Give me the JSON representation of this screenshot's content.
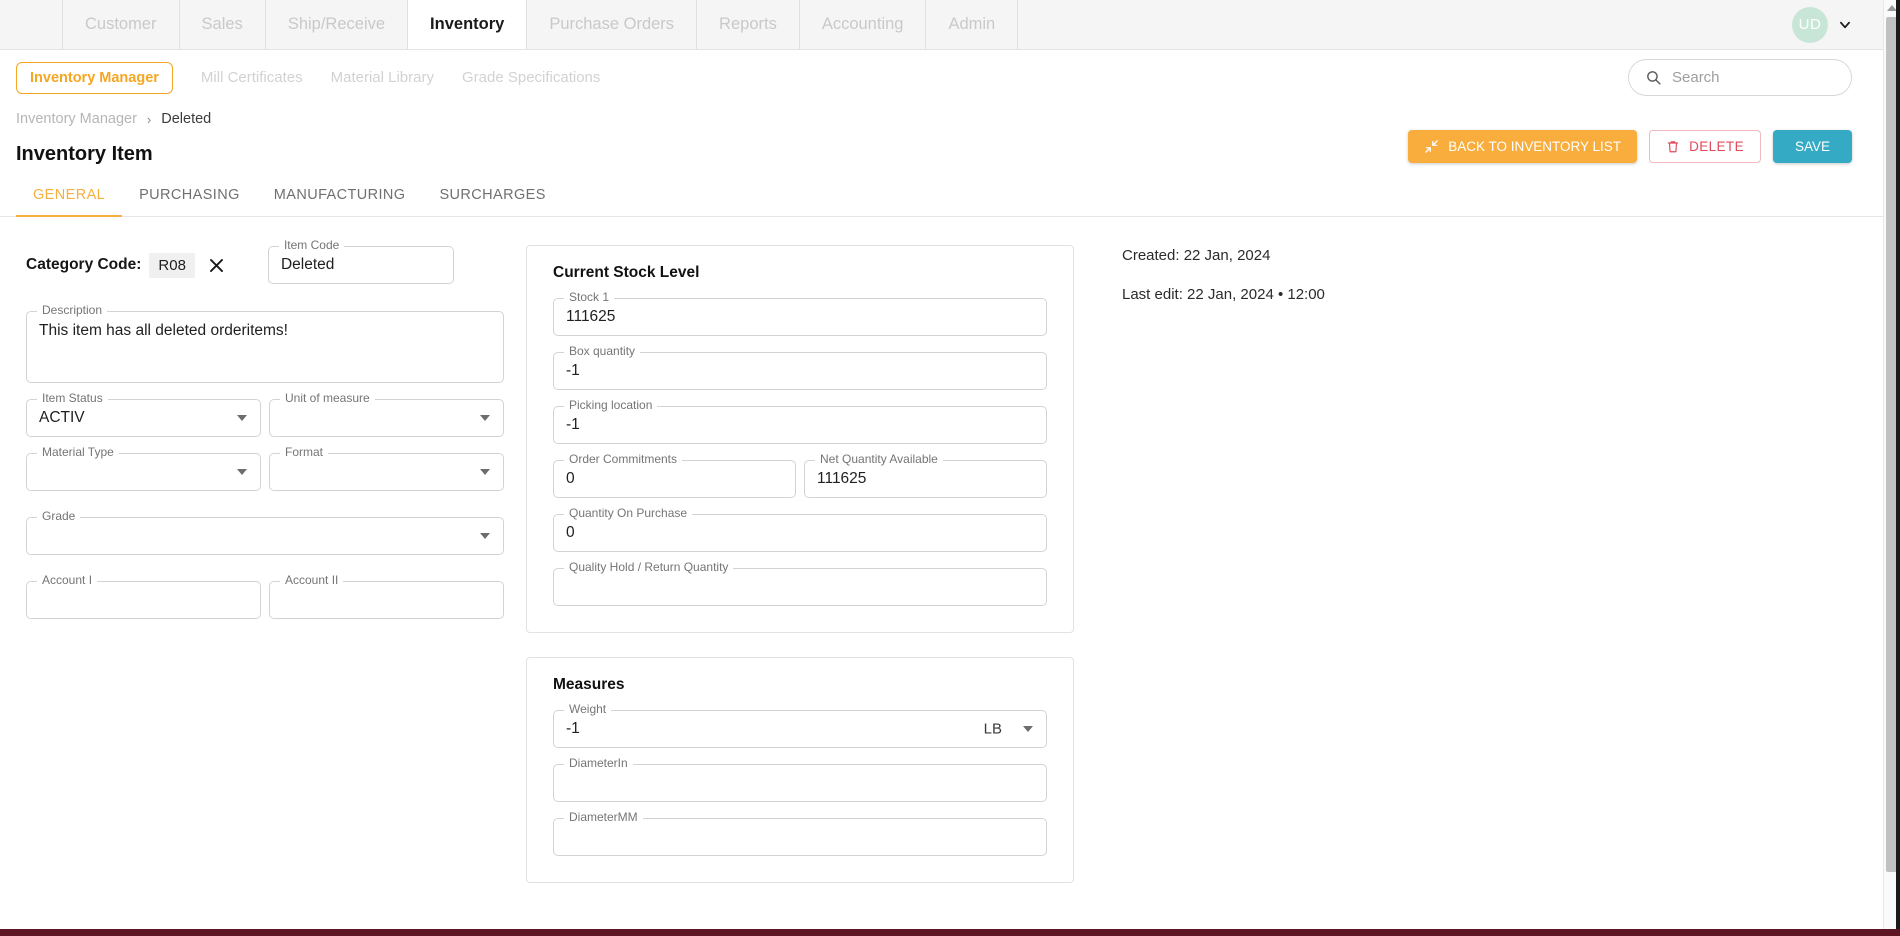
{
  "topnav": {
    "items": [
      {
        "label": "Customer",
        "active": false
      },
      {
        "label": "Sales",
        "active": false
      },
      {
        "label": "Ship/Receive",
        "active": false
      },
      {
        "label": "Inventory",
        "active": true
      },
      {
        "label": "Purchase Orders",
        "active": false
      },
      {
        "label": "Reports",
        "active": false
      },
      {
        "label": "Accounting",
        "active": false
      },
      {
        "label": "Admin",
        "active": false
      }
    ],
    "avatar_initials": "UD",
    "avatar_color": "#c8e6d8"
  },
  "subnav": {
    "active_pill": "Inventory Manager",
    "links": [
      "Mill Certificates",
      "Material Library",
      "Grade Specifications"
    ],
    "search_placeholder": "Search",
    "search_value": ""
  },
  "breadcrumb": {
    "root": "Inventory Manager",
    "separator": "›",
    "current": "Deleted"
  },
  "header": {
    "title": "Inventory Item",
    "back_button": "BACK TO INVENTORY LIST",
    "delete_button": "DELETE",
    "save_button": "SAVE",
    "accent_orange": "#f9ad3c",
    "accent_red": "#e04a5b",
    "accent_teal": "#34aac4"
  },
  "tabs": [
    {
      "label": "GENERAL",
      "active": true
    },
    {
      "label": "PURCHASING",
      "active": false
    },
    {
      "label": "MANUFACTURING",
      "active": false
    },
    {
      "label": "SURCHARGES",
      "active": false
    }
  ],
  "general": {
    "category_code_label": "Category Code:",
    "category_code_value": "R08",
    "item_code": {
      "label": "Item Code",
      "value": "Deleted"
    },
    "description": {
      "label": "Description",
      "value": "This item has all deleted orderitems!"
    },
    "item_status": {
      "label": "Item Status",
      "value": "ACTIV"
    },
    "unit_of_measure": {
      "label": "Unit of measure",
      "value": ""
    },
    "material_type": {
      "label": "Material Type",
      "value": ""
    },
    "format": {
      "label": "Format",
      "value": ""
    },
    "grade": {
      "label": "Grade",
      "value": ""
    },
    "account_i": {
      "label": "Account I",
      "value": ""
    },
    "account_ii": {
      "label": "Account II",
      "value": ""
    }
  },
  "stock_card": {
    "title": "Current Stock Level",
    "stock_1": {
      "label": "Stock 1",
      "value": "111625"
    },
    "box_quantity": {
      "label": "Box quantity",
      "value": "-1"
    },
    "picking_location": {
      "label": "Picking location",
      "value": "-1"
    },
    "order_commitments": {
      "label": "Order Commitments",
      "value": "0"
    },
    "net_quantity_available": {
      "label": "Net Quantity Available",
      "value": "111625"
    },
    "quantity_on_purchase": {
      "label": "Quantity On Purchase",
      "value": "0"
    },
    "quality_hold": {
      "label": "Quality Hold / Return Quantity",
      "value": ""
    }
  },
  "measures_card": {
    "title": "Measures",
    "weight": {
      "label": "Weight",
      "value": "-1",
      "unit": "LB"
    },
    "diameter_in": {
      "label": "DiameterIn",
      "value": ""
    },
    "diameter_mm": {
      "label": "DiameterMM",
      "value": ""
    }
  },
  "meta": {
    "created": "Created: 22 Jan, 2024",
    "last_edit": "Last edit: 22 Jan, 2024 • 12:00"
  }
}
